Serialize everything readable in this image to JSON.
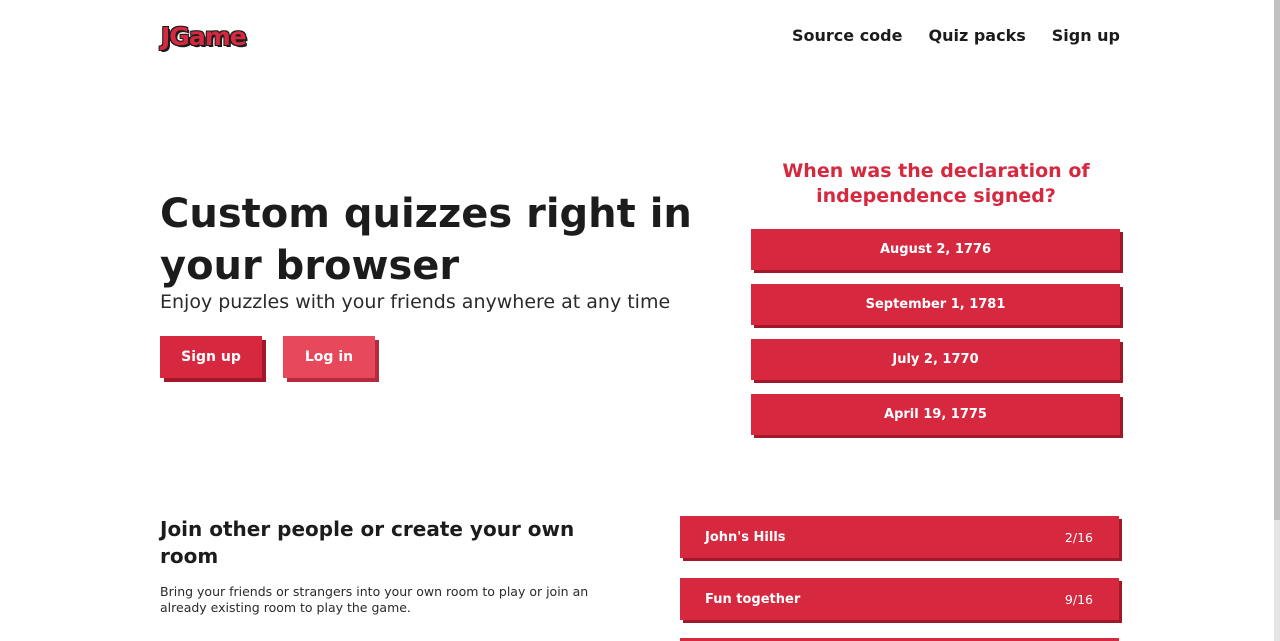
{
  "header": {
    "logo": "JGame",
    "nav": [
      "Source code",
      "Quiz packs",
      "Sign up"
    ]
  },
  "hero": {
    "title": "Custom quizzes right in your browser",
    "subtitle": "Enjoy puzzles with your friends anywhere at any time",
    "signup_label": "Sign up",
    "login_label": "Log in"
  },
  "quiz": {
    "question": "When was the declaration of independence signed?",
    "answers": [
      "August 2, 1776",
      "September 1, 1781",
      "July 2, 1770",
      "April 19, 1775"
    ]
  },
  "rooms_section": {
    "title": "Join other people or create your own room",
    "text": "Bring your friends or strangers into your own room to play or join an already existing room to play the game.",
    "rooms": [
      {
        "name": "John's Hills",
        "count": "2/16"
      },
      {
        "name": "Fun together",
        "count": "9/16"
      }
    ]
  },
  "colors": {
    "accent": "#d62940",
    "accent_shadow": "#a3172b",
    "accent_light": "#e8485b"
  }
}
